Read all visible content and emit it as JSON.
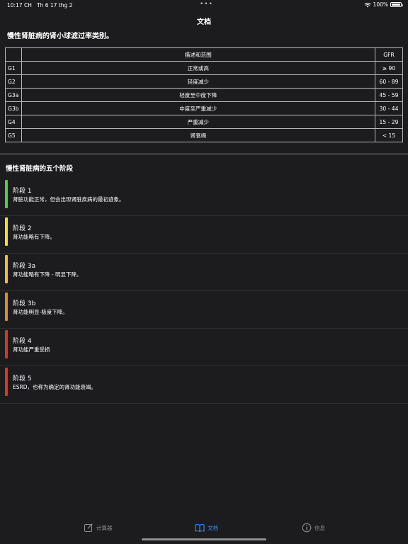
{
  "status": {
    "time": "10:17 CH",
    "date": "Th 6 17 thg 2",
    "battery": "100%",
    "battery_level": 1.0
  },
  "nav": {
    "title": "文档"
  },
  "doc": {
    "title": "慢性肾脏病的肾小球滤过率类别。"
  },
  "table": {
    "header": {
      "code": "",
      "desc": "描述和范围",
      "gfr": "GFR"
    },
    "rows": [
      {
        "code": "G1",
        "desc": "正常或高",
        "gfr": "≥ 90"
      },
      {
        "code": "G2",
        "desc": "轻度减少",
        "gfr": "60 - 89"
      },
      {
        "code": "G3a",
        "desc": "轻度至中度下降",
        "gfr": "45 - 59"
      },
      {
        "code": "G3b",
        "desc": "中度至严重减少",
        "gfr": "30 - 44"
      },
      {
        "code": "G4",
        "desc": "严重减少",
        "gfr": "15 - 29"
      },
      {
        "code": "G5",
        "desc": "肾衰竭",
        "gfr": "< 15"
      }
    ]
  },
  "stages": {
    "title": "慢性肾脏病的五个阶段",
    "items": [
      {
        "name": "阶段 1",
        "desc": "肾脏功能正常，但会出现肾脏疾病的最初迹象。",
        "color": "#4cd13f"
      },
      {
        "name": "阶段 2",
        "desc": "肾功能略有下降。",
        "color": "#f2e21c"
      },
      {
        "name": "阶段 3a",
        "desc": "肾功能略有下降 - 明显下降。",
        "color": "#f2c21b"
      },
      {
        "name": "阶段 3b",
        "desc": "肾功能明显-极度下降。",
        "color": "#e08e16"
      },
      {
        "name": "阶段 4",
        "desc": "肾功能严重受损",
        "color": "#d8352a"
      },
      {
        "name": "阶段 5",
        "desc": "ESRD，也称为确定的肾功能衰竭。",
        "color": "#e8321e"
      }
    ]
  },
  "tabs": {
    "items": [
      {
        "label": "计算器",
        "icon": "calculator-edit-icon",
        "active": false
      },
      {
        "label": "文档",
        "icon": "book-icon",
        "active": true
      },
      {
        "label": "信息",
        "icon": "info-icon",
        "active": false
      }
    ],
    "accent": "#3a8ef6"
  }
}
